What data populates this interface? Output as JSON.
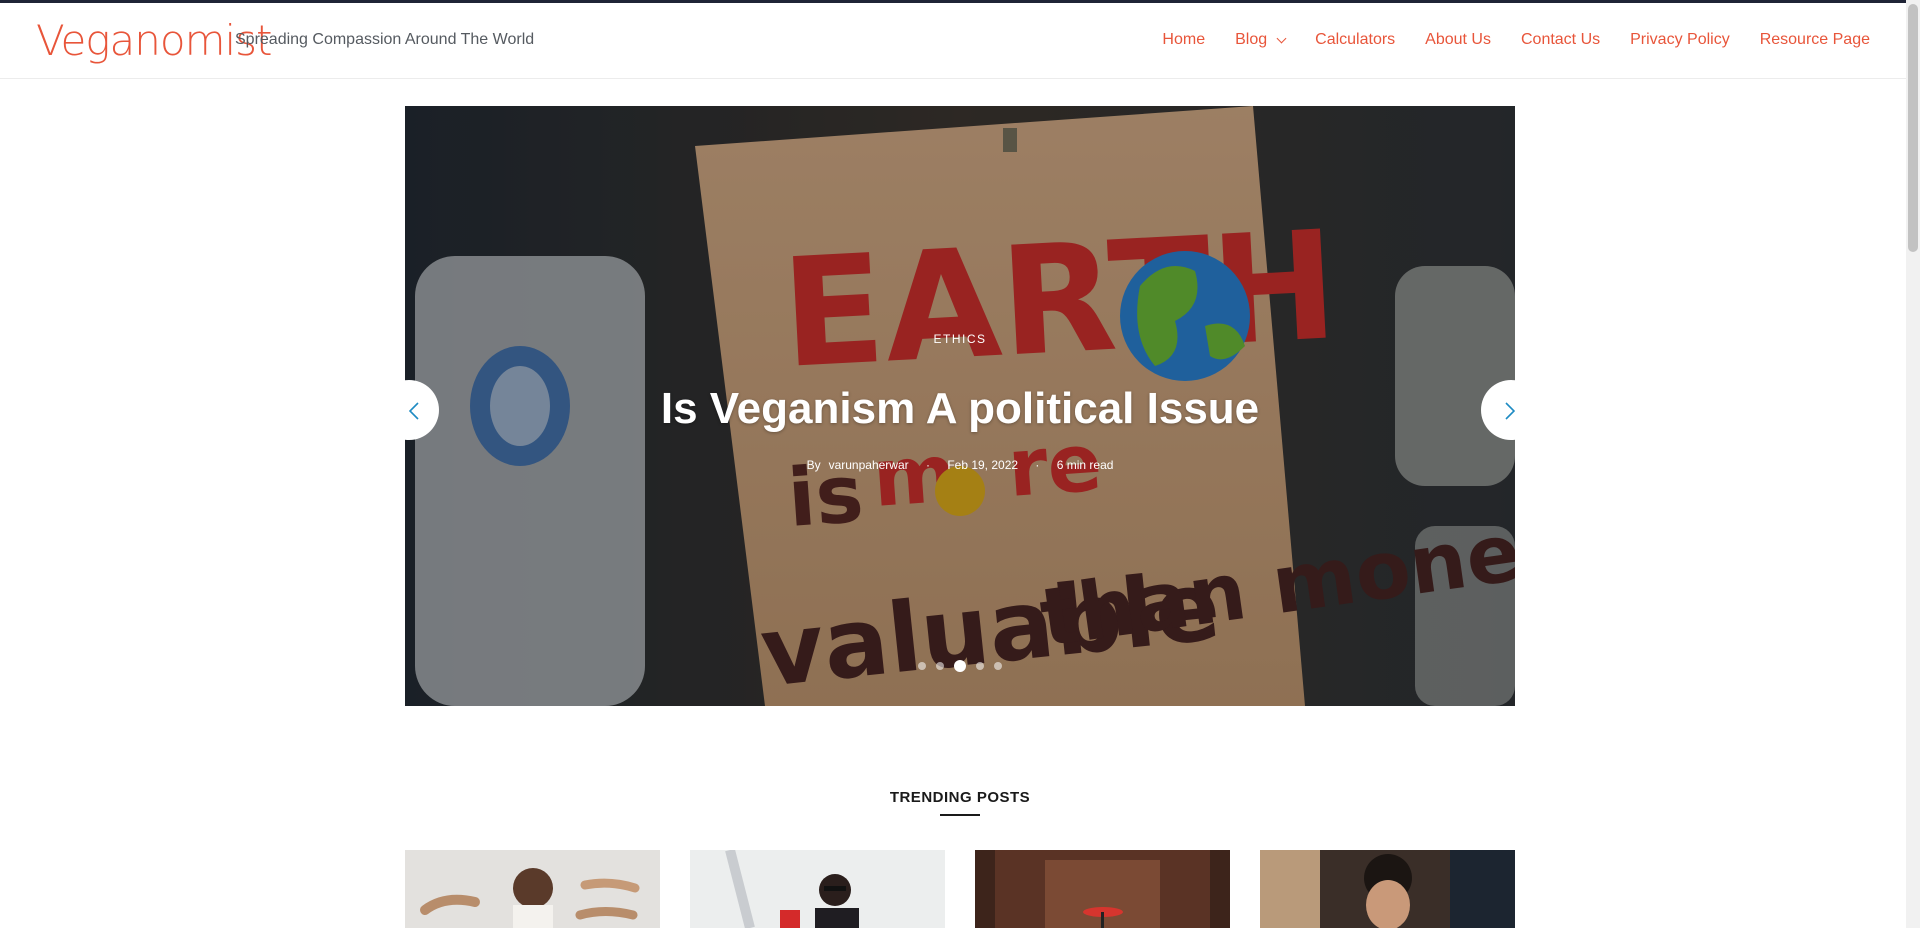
{
  "header": {
    "logo": "Veganomist",
    "tagline": "Spreading Compassion Around The World"
  },
  "nav": {
    "items": [
      "Home",
      "Blog",
      "Calculators",
      "About Us",
      "Contact Us",
      "Privacy Policy",
      "Resource Page"
    ]
  },
  "slider": {
    "category": "ETHICS",
    "title": "Is Veganism A political Issue",
    "author_prefix": "By",
    "author": "varunpaherwar",
    "date": "Feb 19, 2022",
    "read_time": "6 min read",
    "dot_count": 5,
    "active_dot": 3,
    "sign_text": [
      "EARTH",
      "is more",
      "valuable than money"
    ]
  },
  "trending": {
    "title": "TRENDING POSTS"
  },
  "colors": {
    "accent": "#e8553a",
    "arrow": "#1e8bc3"
  }
}
